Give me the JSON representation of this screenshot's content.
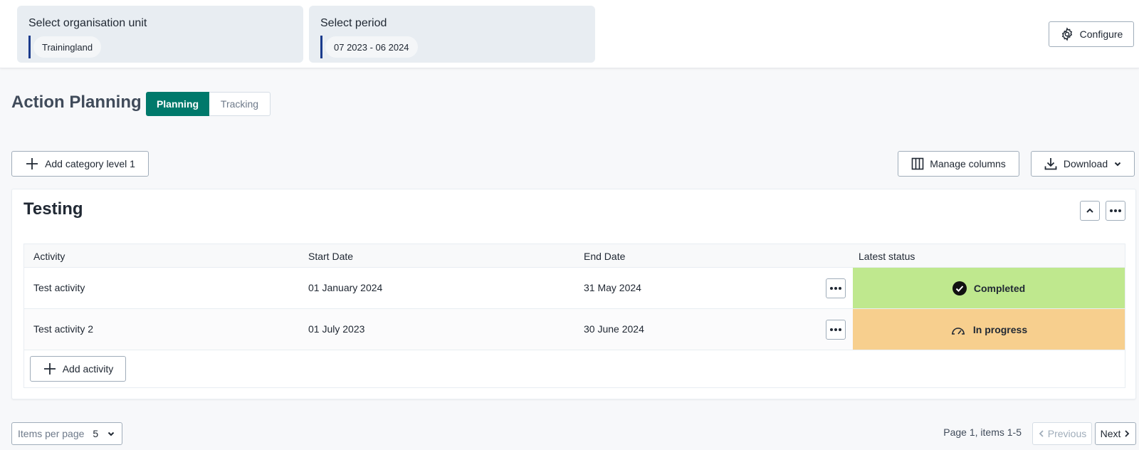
{
  "top": {
    "org_unit": {
      "title": "Select organisation unit",
      "value": "Trainingland"
    },
    "period": {
      "title": "Select period",
      "value": "07 2023 - 06 2024"
    },
    "configure_label": "Configure"
  },
  "page": {
    "title": "Action Planning",
    "tabs": [
      {
        "label": "Planning",
        "active": true
      },
      {
        "label": "Tracking",
        "active": false
      }
    ]
  },
  "toolbar": {
    "add_category_label": "Add category level 1",
    "manage_columns_label": "Manage columns",
    "download_label": "Download"
  },
  "category": {
    "title": "Testing",
    "columns": [
      "Activity",
      "Start Date",
      "End Date",
      "Latest status"
    ],
    "rows": [
      {
        "activity": "Test activity",
        "start": "01 January 2024",
        "end": "31 May 2024",
        "status": "Completed",
        "status_color": "#bfe88e",
        "status_icon": "check-circle-icon"
      },
      {
        "activity": "Test activity 2",
        "start": "01 July 2023",
        "end": "30 June 2024",
        "status": "In progress",
        "status_color": "#f7cf8e",
        "status_icon": "speedometer-icon"
      }
    ],
    "add_activity_label": "Add activity"
  },
  "pagination": {
    "items_per_page_label": "Items per page",
    "items_per_page_value": "5",
    "summary": "Page 1, items 1-5",
    "previous_label": "Previous",
    "next_label": "Next"
  },
  "colors": {
    "primary": "#00796b",
    "accent_line": "#1a3b8c"
  }
}
